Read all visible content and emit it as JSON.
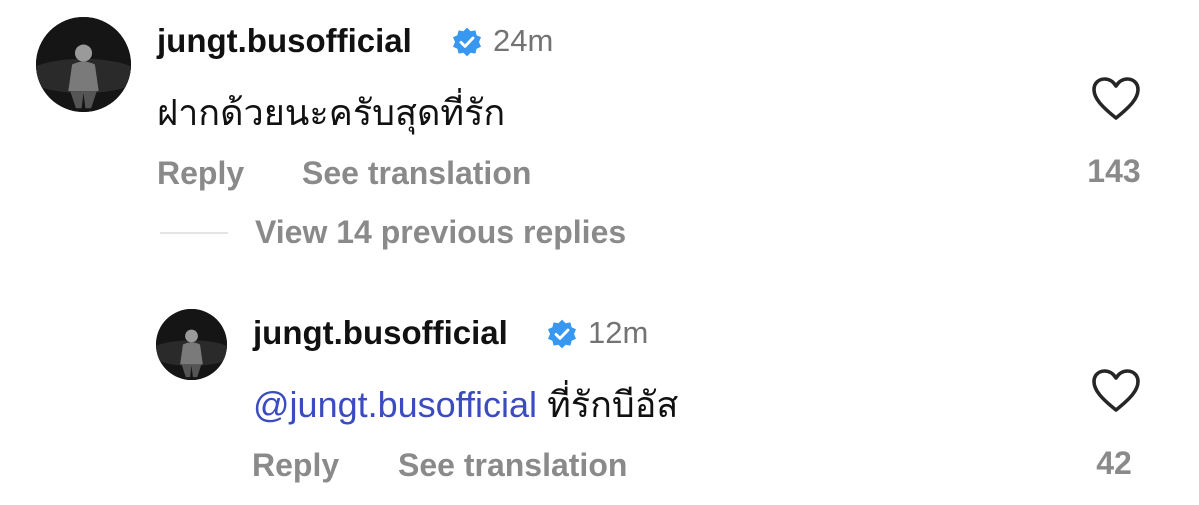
{
  "comment": {
    "username": "jungt.busofficial",
    "time": "24m",
    "text": "ฝากด้วยนะครับสุดที่รัก",
    "reply_label": "Reply",
    "translate_label": "See translation",
    "like_count": "143"
  },
  "view_replies_label": "View 14 previous replies",
  "reply": {
    "username": "jungt.busofficial",
    "time": "12m",
    "mention": "@jungt.busofficial",
    "text": "ที่รักบีอัส",
    "reply_label": "Reply",
    "translate_label": "See translation",
    "like_count": "42"
  },
  "icons": {
    "verified": "verified-badge-icon",
    "like": "heart-outline-icon"
  },
  "colors": {
    "verified_blue": "#3897f0",
    "mention_blue": "#3b4cc0",
    "secondary_text": "#8a8a8a"
  }
}
